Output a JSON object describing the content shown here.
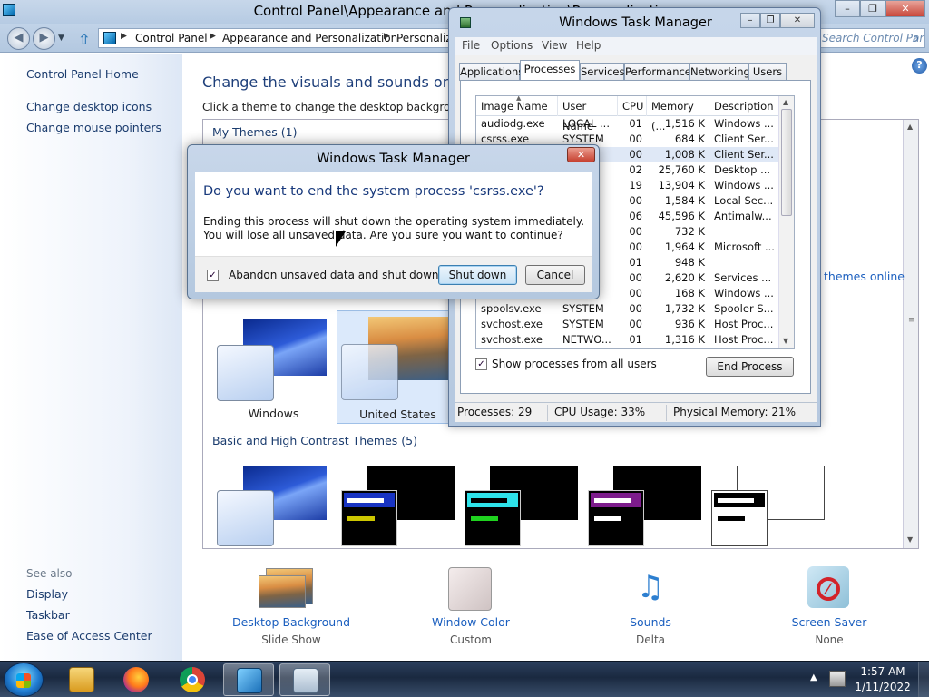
{
  "control_panel": {
    "title": "Control Panel\\Appearance and Personalization\\Personalization",
    "breadcrumbs": [
      "Control Panel",
      "Appearance and Personalization",
      "Personalization"
    ],
    "search_placeholder": "Search Control Panel",
    "sidebar": {
      "home": "Control Panel Home",
      "links": [
        "Change desktop icons",
        "Change mouse pointers"
      ],
      "see_also_label": "See also",
      "see_also": [
        "Display",
        "Taskbar",
        "Ease of Access Center"
      ]
    },
    "main": {
      "title": "Change the visuals and sounds on your computer",
      "subtitle": "Click a theme to change the desktop background, window color, sounds, and screen saver all at once.",
      "my_themes_label": "My Themes (1)",
      "get_more_online": "Get more themes online",
      "aero_themes": [
        {
          "label": "Windows"
        },
        {
          "label": "United States",
          "selected": true
        }
      ],
      "basic_themes_label": "Basic and High Contrast Themes (5)"
    },
    "bottom_items": [
      {
        "label": "Desktop Background",
        "value": "Slide Show",
        "icon": "desktop-background-icon"
      },
      {
        "label": "Window Color",
        "value": "Custom",
        "icon": "window-color-icon"
      },
      {
        "label": "Sounds",
        "value": "Delta",
        "icon": "sounds-icon"
      },
      {
        "label": "Screen Saver",
        "value": "None",
        "icon": "screen-saver-icon"
      }
    ]
  },
  "task_manager": {
    "title": "Windows Task Manager",
    "menu": [
      "File",
      "Options",
      "View",
      "Help"
    ],
    "tabs": [
      "Applications",
      "Processes",
      "Services",
      "Performance",
      "Networking",
      "Users"
    ],
    "active_tab": "Processes",
    "columns": [
      "Image Name",
      "User Name",
      "CPU",
      "Memory (...",
      "Description"
    ],
    "processes": [
      {
        "name": "audiodg.exe",
        "user": "LOCAL ...",
        "cpu": "01",
        "mem": "1,516 K",
        "desc": "Windows ..."
      },
      {
        "name": "csrss.exe",
        "user": "SYSTEM",
        "cpu": "00",
        "mem": "684 K",
        "desc": "Client Ser..."
      },
      {
        "name": "",
        "user": "",
        "cpu": "00",
        "mem": "1,008 K",
        "desc": "Client Ser...",
        "selected": true
      },
      {
        "name": "",
        "user": "",
        "cpu": "02",
        "mem": "25,760 K",
        "desc": "Desktop ..."
      },
      {
        "name": "",
        "user": "",
        "cpu": "19",
        "mem": "13,904 K",
        "desc": "Windows ..."
      },
      {
        "name": "",
        "user": "",
        "cpu": "00",
        "mem": "1,584 K",
        "desc": "Local Sec..."
      },
      {
        "name": "",
        "user": "",
        "cpu": "06",
        "mem": "45,596 K",
        "desc": "Antimalw..."
      },
      {
        "name": "",
        "user": "",
        "cpu": "00",
        "mem": "732 K",
        "desc": ""
      },
      {
        "name": "",
        "user": "",
        "cpu": "00",
        "mem": "1,964 K",
        "desc": "Microsoft ..."
      },
      {
        "name": "",
        "user": "",
        "cpu": "01",
        "mem": "948 K",
        "desc": ""
      },
      {
        "name": "",
        "user": "",
        "cpu": "00",
        "mem": "2,620 K",
        "desc": "Services ..."
      },
      {
        "name": "",
        "user": "",
        "cpu": "00",
        "mem": "168 K",
        "desc": "Windows ..."
      },
      {
        "name": "spoolsv.exe",
        "user": "SYSTEM",
        "cpu": "00",
        "mem": "1,732 K",
        "desc": "Spooler S..."
      },
      {
        "name": "svchost.exe",
        "user": "SYSTEM",
        "cpu": "00",
        "mem": "936 K",
        "desc": "Host Proc..."
      },
      {
        "name": "svchost.exe",
        "user": "NETWO...",
        "cpu": "01",
        "mem": "1,316 K",
        "desc": "Host Proc..."
      }
    ],
    "show_all_label": "Show processes from all users",
    "show_all_checked": true,
    "end_process_label": "End Process",
    "status": {
      "processes": "Processes: 29",
      "cpu": "CPU Usage: 33%",
      "memory": "Physical Memory: 21%"
    }
  },
  "dialog": {
    "title": "Windows Task Manager",
    "question": "Do you want to end the system process 'csrss.exe'?",
    "message": "Ending this process will shut down the operating system immediately.  You will lose all unsaved data.  Are you sure you want to continue?",
    "checkbox_label": "Abandon unsaved data and shut down.",
    "checkbox_checked": true,
    "shutdown_label": "Shut down",
    "cancel_label": "Cancel"
  },
  "taskbar": {
    "time": "1:57 AM",
    "date": "1/11/2022",
    "apps": [
      "explorer-icon",
      "firefox-icon",
      "chrome-icon",
      "control-panel-icon",
      "task-manager-icon"
    ]
  },
  "colors": {
    "link": "#1b5fbf",
    "heading": "#1e3f7a",
    "selection": "#dfe8f6"
  }
}
